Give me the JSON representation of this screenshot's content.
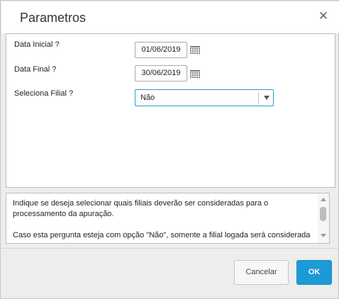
{
  "dialog": {
    "title": "Parametros",
    "close_icon": "close-icon"
  },
  "form": {
    "start_date": {
      "label": "Data Inicial ?",
      "value": "01/06/2019",
      "icon": "calendar-icon"
    },
    "end_date": {
      "label": "Data Final ?",
      "value": "30/06/2019",
      "icon": "calendar-icon"
    },
    "branch": {
      "label": "Seleciona Filial ?",
      "value": "Não",
      "icon": "chevron-down-icon"
    }
  },
  "help": {
    "paragraph1": "Indique se deseja selecionar quais filiais deverão ser consideradas para o processamento da apuração.",
    "paragraph2": "Caso esta pergunta esteja com opção \"Não\", somente a filial logada será considerada no processamento."
  },
  "buttons": {
    "cancel_label": "Cancelar",
    "ok_label": "OK"
  },
  "colors": {
    "accent": "#1d9ad6",
    "select_border": "#2c9bc9",
    "dialog_bg": "#ededed"
  }
}
